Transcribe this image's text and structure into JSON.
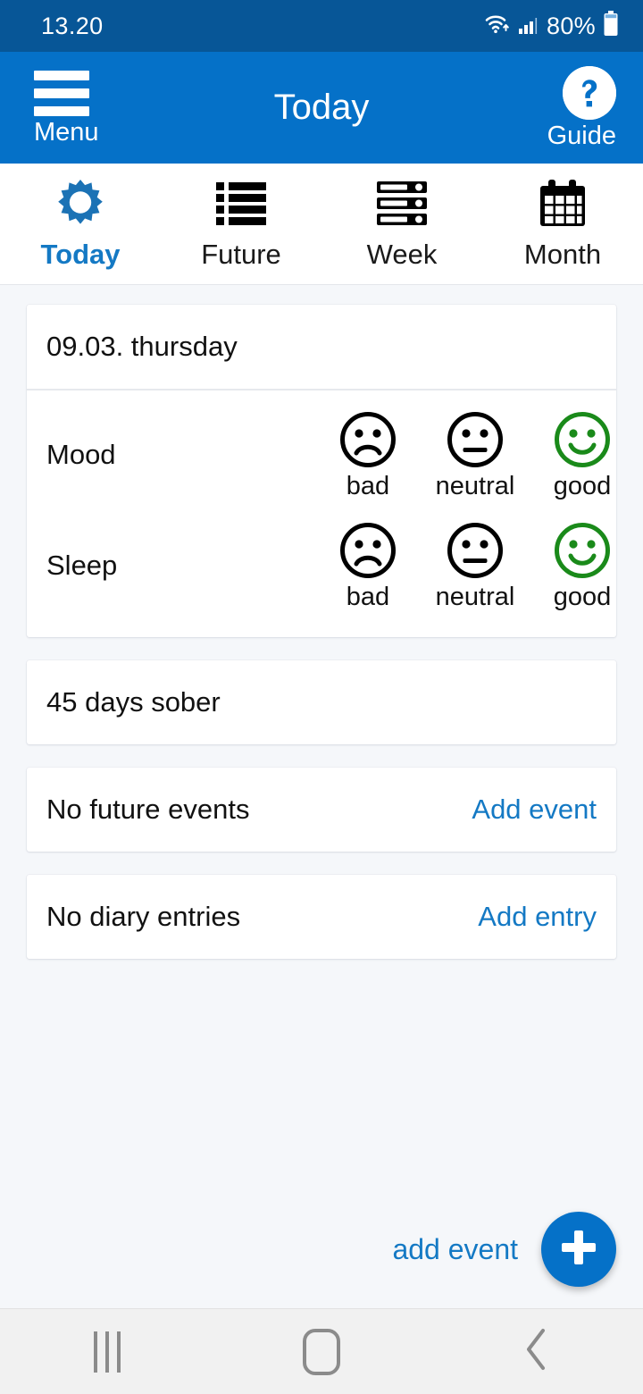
{
  "status_bar": {
    "time": "13.20",
    "battery_percent": "80%",
    "icons": [
      "wifi-icon",
      "cellular-signal-icon",
      "battery-icon"
    ]
  },
  "app_bar": {
    "menu_label": "Menu",
    "menu_icon": "hamburger-menu-icon",
    "title": "Today",
    "guide_label": "Guide",
    "guide_icon": "question-mark-circle-icon"
  },
  "tabs": [
    {
      "label": "Today",
      "icon": "sun-icon",
      "active": true
    },
    {
      "label": "Future",
      "icon": "bullet-list-icon",
      "active": false
    },
    {
      "label": "Week",
      "icon": "week-rows-icon",
      "active": false
    },
    {
      "label": "Month",
      "icon": "calendar-icon",
      "active": false
    }
  ],
  "main": {
    "date": "09.03. thursday",
    "ratings": [
      {
        "label": "Mood",
        "options": [
          {
            "caption": "bad",
            "face": "sad-face-icon",
            "selected": false
          },
          {
            "caption": "neutral",
            "face": "neutral-face-icon",
            "selected": false
          },
          {
            "caption": "good",
            "face": "happy-face-icon",
            "selected": true
          }
        ]
      },
      {
        "label": "Sleep",
        "options": [
          {
            "caption": "bad",
            "face": "sad-face-icon",
            "selected": false
          },
          {
            "caption": "neutral",
            "face": "neutral-face-icon",
            "selected": false
          },
          {
            "caption": "good",
            "face": "happy-face-icon",
            "selected": true
          }
        ]
      }
    ],
    "sober_counter": "45 days sober",
    "future_events": {
      "text": "No future events",
      "action_label": "Add event"
    },
    "diary_entries": {
      "text": "No diary entries",
      "action_label": "Add entry"
    }
  },
  "fab": {
    "label": "add event",
    "icon": "plus-icon"
  },
  "nav_bar": {
    "recents_icon": "recents-icon",
    "home_icon": "home-icon",
    "back_icon": "back-chevron-icon"
  },
  "colors": {
    "status_bar_blue": "#075697",
    "app_bar_blue": "#0571c8",
    "accent_blue": "#1479c4",
    "selected_green": "#1a8a1a",
    "page_background": "#f5f7fa",
    "card_white": "#ffffff",
    "text_dark": "#111111"
  }
}
